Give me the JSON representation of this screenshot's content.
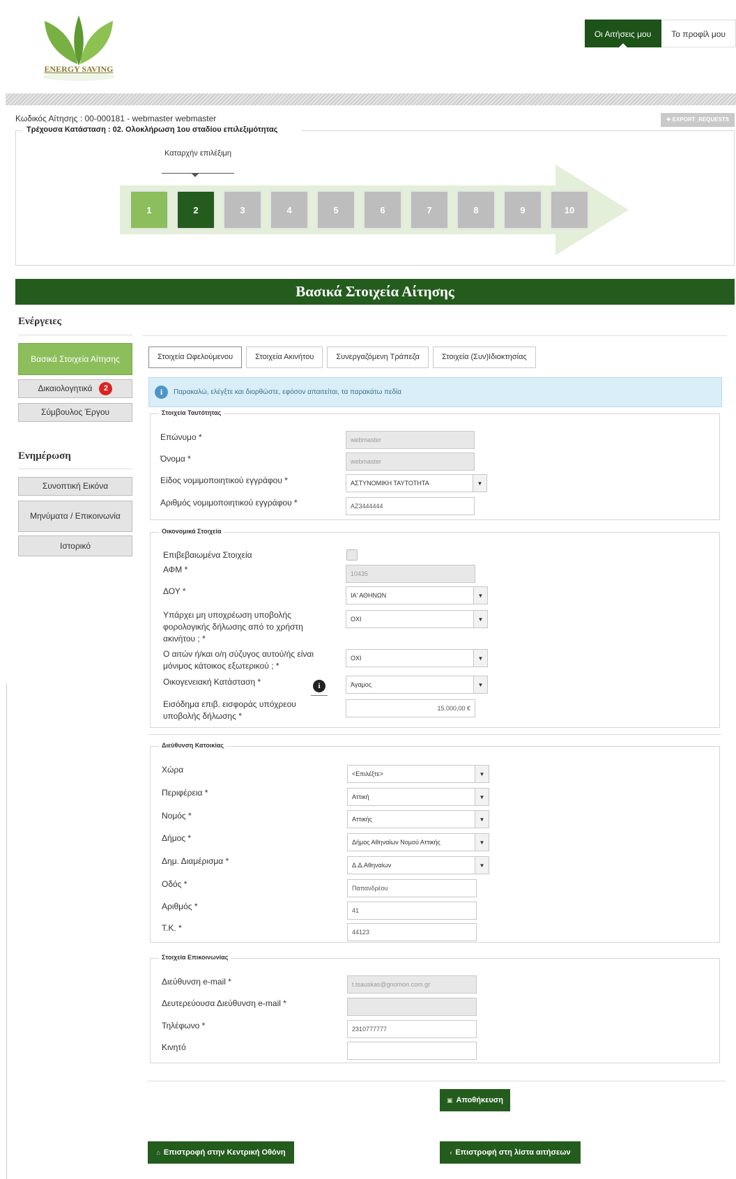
{
  "header": {
    "logo_text": "ENERGY SAVING",
    "nav": [
      {
        "label": "Οι Αιτήσεις μου",
        "active": true
      },
      {
        "label": "Το προφίλ μου",
        "active": false
      }
    ]
  },
  "application": {
    "code_line": "Κωδικός Αίτησης : 00-000181 - webmaster webmaster",
    "export_label": "EXPORT_REQUESTS",
    "status_label": "Τρέχουσα Κατάσταση : 02. Ολοκλήρωση 1ου σταδίου επιλεξιμότητας",
    "step_caption": "Καταρχήν επιλέξιμη",
    "steps": [
      {
        "label": "1",
        "state": "done"
      },
      {
        "label": "2",
        "state": "current"
      },
      {
        "label": "3",
        "state": "pending"
      },
      {
        "label": "4",
        "state": "pending"
      },
      {
        "label": "5",
        "state": "pending"
      },
      {
        "label": "6",
        "state": "pending"
      },
      {
        "label": "7",
        "state": "pending"
      },
      {
        "label": "8",
        "state": "pending"
      },
      {
        "label": "9",
        "state": "pending"
      },
      {
        "label": "10",
        "state": "pending"
      }
    ]
  },
  "banner": {
    "title": "Βασικά Στοιχεία Αίτησης"
  },
  "sidebar": {
    "actions_heading": "Ενέργειες",
    "actions": [
      {
        "label": "Βασικά Στοιχεία Αίτησης",
        "active": true
      },
      {
        "label": "Δικαιολογητικά",
        "badge": "2"
      },
      {
        "label": "Σύμβουλος Έργου"
      }
    ],
    "info_heading": "Ενημέρωση",
    "info": [
      {
        "label": "Συνοπτική Εικόνα"
      },
      {
        "label": "Μηνύματα / Επικοινωνία"
      },
      {
        "label": "Ιστορικό"
      }
    ]
  },
  "tabs": [
    {
      "label": "Στοιχεία Ωφελούμενου",
      "active": true
    },
    {
      "label": "Στοιχεία Ακινήτου"
    },
    {
      "label": "Συνεργαζόμενη Τράπεζα"
    },
    {
      "label": "Στοιχεία (Συν)Ιδιοκτησίας"
    }
  ],
  "info_message": "Παρακαλώ, ελέγξτε και διορθώστε, εφόσον απαιτείται, τα παρακάτω πεδία",
  "identity": {
    "legend": "Στοιχεία Ταυτότητας",
    "surname_label": "Επώνυμο *",
    "surname": "webmaster",
    "name_label": "Όνομα *",
    "name": "webmaster",
    "doc_type_label": "Είδος νομιμοποιητικού εγγράφου *",
    "doc_type": "ΑΣΤΥΝΟΜΙΚΗ ΤΑΥΤΟΤΗΤΑ",
    "doc_number_label": "Αριθμός νομιμοποιητικού εγγράφου *",
    "doc_number": "ΑΖ3444444"
  },
  "financial": {
    "legend": "Οικονομικά Στοιχεία",
    "verified_label": "Επιβεβαιωμένα Στοιχεία",
    "afm_label": "ΑΦΜ *",
    "afm": "10435",
    "doy_label": "ΔΟΥ *",
    "doy": "ΙΑ' ΑΘΗΝΩΝ",
    "no_tax_label": "Υπάρχει μη υποχρέωση υποβολής φορολογικής δήλωσης από το χρήστη ακινήτου ; *",
    "no_tax": "ΟΧΙ",
    "abroad_label": "Ο αιτών ή/και ο/η σύζυγος αυτού/ής είναι μόνιμος κάτοικος εξωτερικού ; *",
    "abroad": "ΟΧΙ",
    "family_label": "Οικογενειακή Κατάσταση *",
    "family": "Άγαμος",
    "income_label": "Εισόδημα επιβ. εισφοράς υπόχρεου υποβολής δήλωσης *",
    "income": "15.000,00 €"
  },
  "address": {
    "legend": "Διεύθυνση Κατοικίας",
    "country_label": "Χώρα",
    "country": "<Επιλέξτε>",
    "region_label": "Περιφέρεια *",
    "region": "Αττική",
    "prefecture_label": "Νομός *",
    "prefecture": "Αττικής",
    "municipality_label": "Δήμος *",
    "municipality": "Δήμος Αθηναίων Νομού Αττικής",
    "district_label": "Δημ. Διαμέρισμα *",
    "district": "Δ.Δ.Αθηναίων",
    "street_label": "Οδός *",
    "street": "Παπανδρέου",
    "number_label": "Αριθμός *",
    "number": "41",
    "zip_label": "Τ.Κ. *",
    "zip": "44123"
  },
  "contact": {
    "legend": "Στοιχεία Επικοινωνίας",
    "email_label": "Διεύθυνση e-mail *",
    "email": "t.tsauskas@gnomon.com.gr",
    "email2_label": "Δευτερεύουσα Διεύθυνση e-mail *",
    "email2": "",
    "phone_label": "Τηλέφωνο *",
    "phone": "2310777777",
    "mobile_label": "Κινητό",
    "mobile": ""
  },
  "buttons": {
    "save": "Αποθήκευση",
    "home": "Επιστροφή στην Κεντρική Οθόνη",
    "back_list": "Επιστροφή στη λίστα αιτήσεων"
  }
}
